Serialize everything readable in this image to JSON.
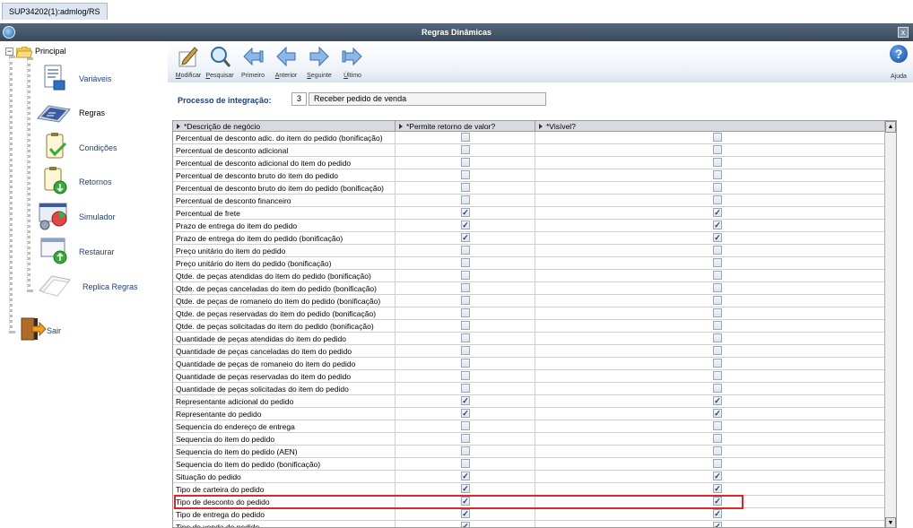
{
  "window": {
    "tab_label": "SUP34202(1):admlog/RS",
    "title": "Regras Dinâmicas",
    "close_label": "x"
  },
  "sidebar": {
    "root_label": "Principal",
    "expander_label": "−",
    "items": [
      {
        "label": "Variáveis",
        "icon": "variables-icon"
      },
      {
        "label": "Regras",
        "icon": "rules-icon"
      },
      {
        "label": "Condições",
        "icon": "conditions-icon"
      },
      {
        "label": "Retornos",
        "icon": "returns-icon"
      },
      {
        "label": "Simulador",
        "icon": "simulator-icon"
      },
      {
        "label": "Restaurar",
        "icon": "restore-icon"
      },
      {
        "label": "Replica Regras",
        "icon": "replicate-icon"
      },
      {
        "label": "Sair",
        "icon": "exit-icon"
      }
    ],
    "selected": "Regras"
  },
  "toolbar": {
    "buttons": [
      {
        "label": "Modificar",
        "accel": "M",
        "rest": "odificar"
      },
      {
        "label": "Pesquisar",
        "accel": "P",
        "rest": "esquisar"
      },
      {
        "label": "Primeiro",
        "accel": "",
        "rest": "Primeiro"
      },
      {
        "label": "Anterior",
        "accel": "A",
        "rest": "nterior"
      },
      {
        "label": "Seguinte",
        "accel": "S",
        "rest": "eguinte"
      },
      {
        "label": "Último",
        "accel": "Ú",
        "rest": "ltimo"
      }
    ],
    "help_label": "Ajuda",
    "help_glyph": "?"
  },
  "process": {
    "label": "Processo de integração:",
    "code": "3",
    "name": "Receber pedido de venda"
  },
  "grid": {
    "columns": [
      "*Descrição de negócio",
      "*Permite retorno de valor?",
      "*Visível?"
    ],
    "rows": [
      {
        "desc": "Percentual de desconto adic. do item do pedido (bonificação)",
        "retorno": false,
        "visivel": false
      },
      {
        "desc": "Percentual de desconto adicional",
        "retorno": false,
        "visivel": false
      },
      {
        "desc": "Percentual de desconto adicional do item do pedido",
        "retorno": false,
        "visivel": false
      },
      {
        "desc": "Percentual de desconto bruto do item do pedido",
        "retorno": false,
        "visivel": false
      },
      {
        "desc": "Percentual de desconto bruto do item do pedido (bonificação)",
        "retorno": false,
        "visivel": false
      },
      {
        "desc": "Percentual de desconto financeiro",
        "retorno": false,
        "visivel": false
      },
      {
        "desc": "Percentual de frete",
        "retorno": true,
        "visivel": true
      },
      {
        "desc": "Prazo de entrega do item do pedido",
        "retorno": true,
        "visivel": true
      },
      {
        "desc": "Prazo de entrega do item do pedido (bonificação)",
        "retorno": true,
        "visivel": true
      },
      {
        "desc": "Preço unitário do item do pedido",
        "retorno": false,
        "visivel": false
      },
      {
        "desc": "Preço unitário do item do pedido (bonificação)",
        "retorno": false,
        "visivel": false
      },
      {
        "desc": "Qtde. de peças atendidas do item do pedido (bonificação)",
        "retorno": false,
        "visivel": false
      },
      {
        "desc": "Qtde. de peças canceladas do item do pedido (bonificação)",
        "retorno": false,
        "visivel": false
      },
      {
        "desc": "Qtde. de peças de romaneio do item do pedido (bonificação)",
        "retorno": false,
        "visivel": false
      },
      {
        "desc": "Qtde. de peças reservadas do item do pedido (bonificação)",
        "retorno": false,
        "visivel": false
      },
      {
        "desc": "Qtde. de peças solicitadas do item do pedido (bonificação)",
        "retorno": false,
        "visivel": false
      },
      {
        "desc": "Quantidade de peças atendidas do item do pedido",
        "retorno": false,
        "visivel": false
      },
      {
        "desc": "Quantidade de peças canceladas do item do pedido",
        "retorno": false,
        "visivel": false
      },
      {
        "desc": "Quantidade de peças de romaneio do item do pedido",
        "retorno": false,
        "visivel": false
      },
      {
        "desc": "Quantidade de peças reservadas do item do pedido",
        "retorno": false,
        "visivel": false
      },
      {
        "desc": "Quantidade de peças solicitadas do item do pedido",
        "retorno": false,
        "visivel": false
      },
      {
        "desc": "Representante adicional do pedido",
        "retorno": true,
        "visivel": true
      },
      {
        "desc": "Representante do pedido",
        "retorno": true,
        "visivel": true
      },
      {
        "desc": "Sequencia do endereço de entrega",
        "retorno": false,
        "visivel": false
      },
      {
        "desc": "Sequencia do item do pedido",
        "retorno": false,
        "visivel": false
      },
      {
        "desc": "Sequencia do item do pedido (AEN)",
        "retorno": false,
        "visivel": false
      },
      {
        "desc": "Sequencia do item do pedido (bonificação)",
        "retorno": false,
        "visivel": false
      },
      {
        "desc": "Situação do pedido",
        "retorno": true,
        "visivel": true
      },
      {
        "desc": "Tipo de carteira do pedido",
        "retorno": true,
        "visivel": true
      },
      {
        "desc": "Tipo de desconto do pedido",
        "retorno": true,
        "visivel": true
      },
      {
        "desc": "Tipo de entrega do pedido",
        "retorno": true,
        "visivel": true
      },
      {
        "desc": "Tipo de venda do pedido",
        "retorno": true,
        "visivel": true
      }
    ],
    "highlighted_row": "Tipo de desconto do pedido",
    "check_glyph": "✓",
    "scroll_up": "▲",
    "scroll_down": "▼",
    "highlight_color": "#e0252b"
  }
}
